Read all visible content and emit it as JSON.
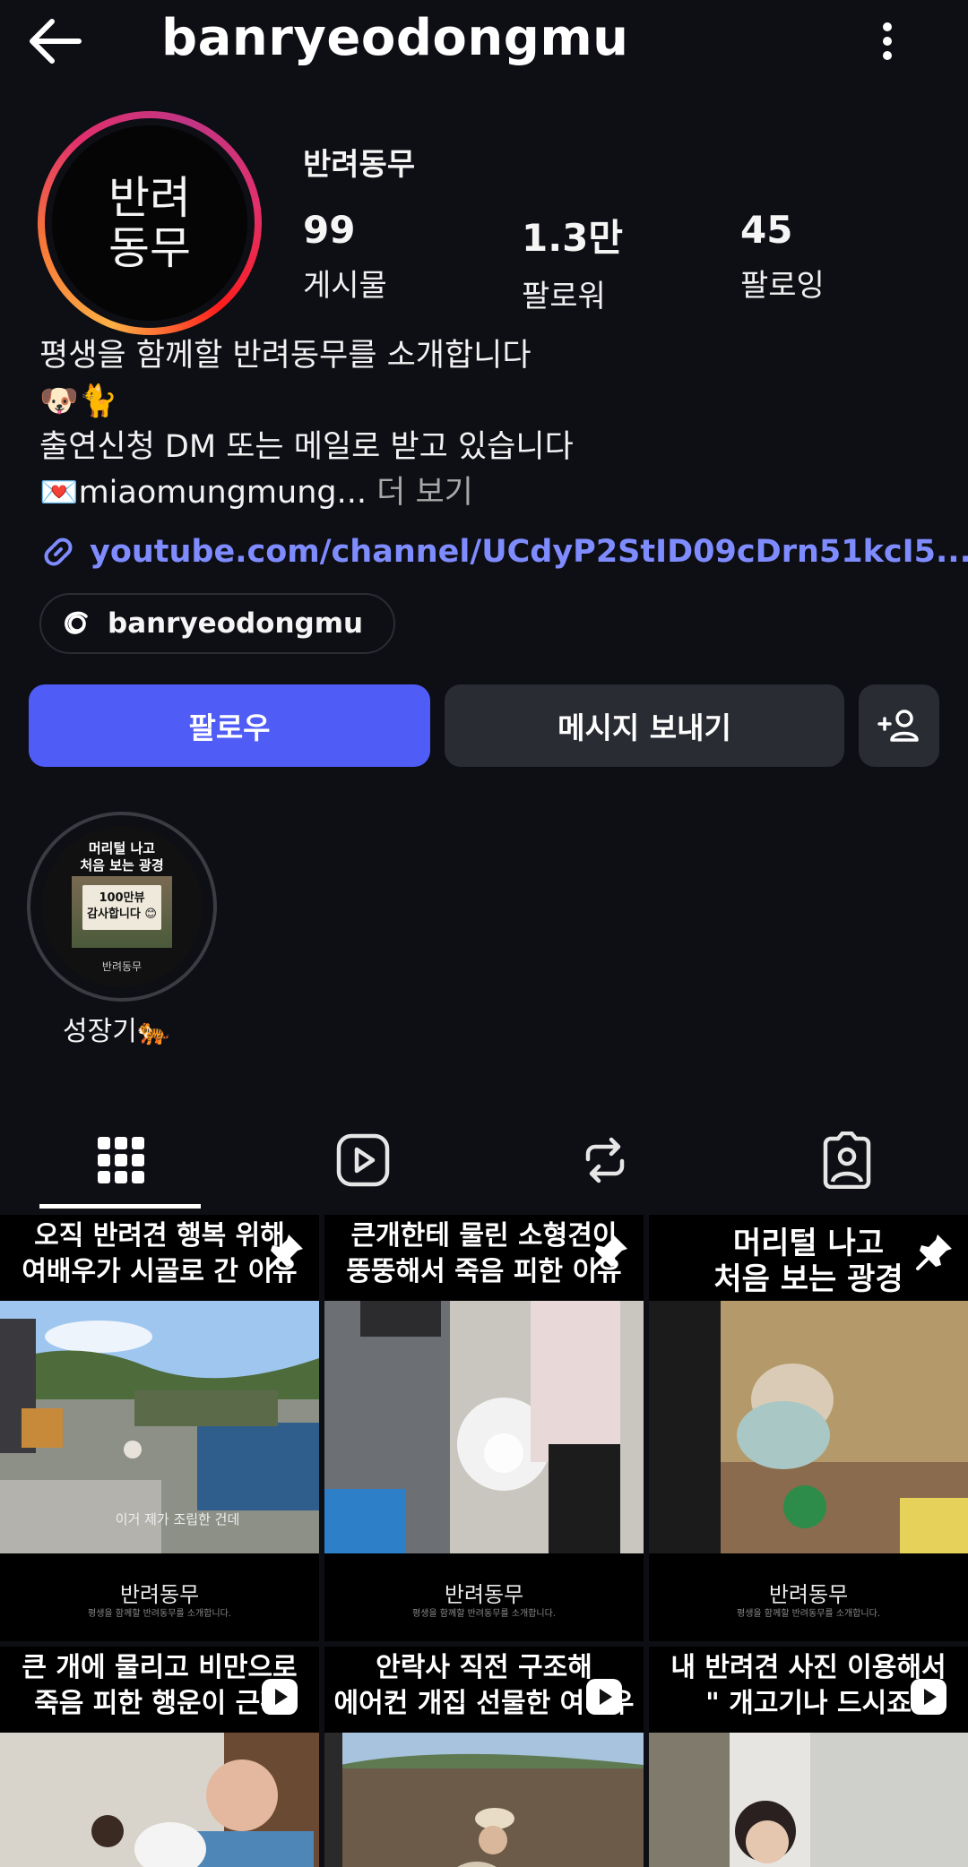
{
  "header": {
    "username": "banryeodongmu",
    "back_icon": "arrow-left-icon",
    "more_icon": "more-vertical-icon"
  },
  "profile": {
    "avatar_line1": "반려",
    "avatar_line2": "동무",
    "display_name": "반려동무",
    "stats": [
      {
        "value": "99",
        "label": "게시물"
      },
      {
        "value": "1.3만",
        "label": "팔로워"
      },
      {
        "value": "45",
        "label": "팔로잉"
      }
    ],
    "bio": {
      "line1": "평생을 함께할 반려동무를 소개합니다",
      "line2": "🐶🐈",
      "line3": "출연신청 DM 또는 메일로 받고 있습니다",
      "line4": "💌miaomungmung...",
      "more": " 더 보기"
    },
    "link": "youtube.com/channel/UCdyP2StID09cDrn51kcI5...",
    "threads_handle": "banryeodongmu"
  },
  "actions": {
    "follow": "팔로우",
    "message": "메시지 보내기",
    "add_user_icon": "add-person-icon"
  },
  "highlights": [
    {
      "label": "성장기🐅",
      "cover_title_1": "머리털 나고",
      "cover_title_2": "처음 보는 광경",
      "cover_box_1": "100만뷰",
      "cover_box_2": "감사합니다 😊",
      "cover_brand": "반려동무"
    }
  ],
  "tabs": [
    {
      "name": "grid",
      "icon": "grid-icon",
      "active": true
    },
    {
      "name": "reels",
      "icon": "reels-icon",
      "active": false
    },
    {
      "name": "reposts",
      "icon": "repost-icon",
      "active": false
    },
    {
      "name": "tagged",
      "icon": "tagged-icon",
      "active": false
    }
  ],
  "posts": [
    {
      "cap1": "오직 반려견 행복 위해",
      "cap2": "여배우가 시골로 간 이유",
      "brand": "반려동무",
      "brand_sub": "평생을 함께할 반려동무를 소개합니다.",
      "overlay": "이거 제가 조립한 건데",
      "badge": "pin-icon"
    },
    {
      "cap1": "큰개한테 물린 소형견이",
      "cap2": "뚱뚱해서 죽음 피한 이유",
      "brand": "반려동무",
      "brand_sub": "평생을 함께할 반려동무를 소개합니다.",
      "overlay": "",
      "badge": "pin-icon"
    },
    {
      "cap1": "머리털 나고",
      "cap2": "처음 보는 광경",
      "brand": "반려동무",
      "brand_sub": "평생을 함께할 반려동무를 소개합니다.",
      "overlay": "",
      "badge": "pin-icon"
    },
    {
      "cap1": "큰 개에 물리고 비만으로",
      "cap2": "죽음 피한 행운이 근황",
      "badge": "reel-icon"
    },
    {
      "cap1": "안락사 직전 구조해",
      "cap2": "에어컨 개집 선물한 여배우",
      "badge": "reel-icon"
    },
    {
      "cap1": "내 반려견 사진 이용해서",
      "cap2": "\" 개고기나 드시죠",
      "badge": "reel-icon"
    }
  ],
  "colors": {
    "background": "#0e0e15",
    "follow_button": "#4f5cf6",
    "secondary_button": "#2a2c33",
    "link": "#7e8cff"
  }
}
